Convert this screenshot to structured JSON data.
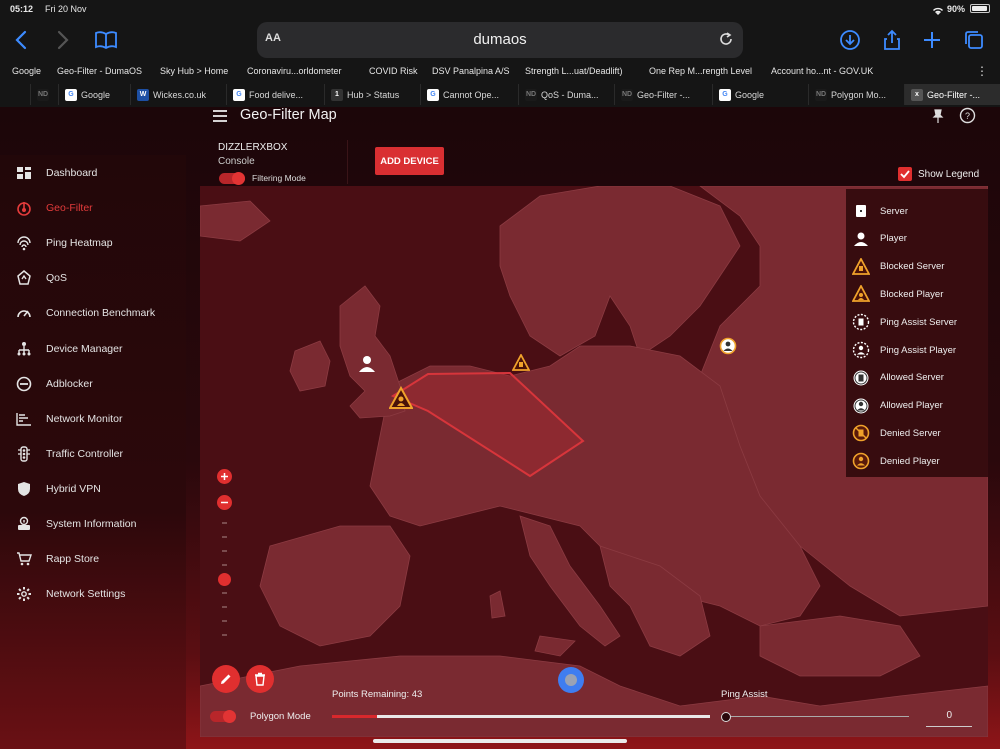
{
  "status_bar": {
    "time": "05:12",
    "date": "Fri 20 Nov",
    "battery": "90%"
  },
  "browser": {
    "text_size_label": "AA",
    "url": "dumaos",
    "bookmarks": [
      "Google",
      "Geo-Filter - DumaOS",
      "Sky Hub > Home",
      "Coronaviru...orldometer",
      "COVID Risk",
      "DSV Panalpina A/S",
      "Strength L...uat/Deadlift)",
      "One Rep M...rength Level",
      "Account ho...nt - GOV.UK"
    ],
    "tabs": [
      {
        "label": "",
        "fav": "ND",
        "favbg": "#1a1a1a",
        "favcolor": "#777"
      },
      {
        "label": "Google",
        "fav": "G",
        "favbg": "#fff",
        "favcolor": "#4285f4"
      },
      {
        "label": "Wickes.co.uk",
        "fav": "W",
        "favbg": "#1d4fa3",
        "favcolor": "#fff"
      },
      {
        "label": "Food delive...",
        "fav": "G",
        "favbg": "#fff",
        "favcolor": "#4285f4"
      },
      {
        "label": "Hub > Status",
        "fav": "1",
        "favbg": "#333",
        "favcolor": "#fff"
      },
      {
        "label": "Cannot Ope...",
        "fav": "G",
        "favbg": "#fff",
        "favcolor": "#4285f4"
      },
      {
        "label": "QoS - Duma...",
        "fav": "ND",
        "favbg": "#1a1a1a",
        "favcolor": "#777"
      },
      {
        "label": "Geo-Filter -...",
        "fav": "ND",
        "favbg": "#1a1a1a",
        "favcolor": "#777"
      },
      {
        "label": "Google",
        "fav": "G",
        "favbg": "#fff",
        "favcolor": "#4285f4"
      },
      {
        "label": "Polygon Mo...",
        "fav": "ND",
        "favbg": "#1a1a1a",
        "favcolor": "#777"
      },
      {
        "label": "Geo-Filter -...",
        "fav": "x",
        "favbg": "#555",
        "favcolor": "#fff",
        "active": true
      }
    ]
  },
  "app": {
    "title": "Geo-Filter Map"
  },
  "sidebar": {
    "items": [
      {
        "label": "Dashboard",
        "icon": "dashboard-icon"
      },
      {
        "label": "Geo-Filter",
        "icon": "geo-filter-icon",
        "active": true
      },
      {
        "label": "Ping Heatmap",
        "icon": "ping-heatmap-icon"
      },
      {
        "label": "QoS",
        "icon": "qos-icon"
      },
      {
        "label": "Connection Benchmark",
        "icon": "speedometer-icon"
      },
      {
        "label": "Device Manager",
        "icon": "device-tree-icon"
      },
      {
        "label": "Adblocker",
        "icon": "block-icon"
      },
      {
        "label": "Network Monitor",
        "icon": "monitor-icon"
      },
      {
        "label": "Traffic Controller",
        "icon": "traffic-light-icon"
      },
      {
        "label": "Hybrid VPN",
        "icon": "shield-icon"
      },
      {
        "label": "System Information",
        "icon": "system-info-icon"
      },
      {
        "label": "Rapp Store",
        "icon": "cart-icon"
      },
      {
        "label": "Network Settings",
        "icon": "gear-icon"
      }
    ]
  },
  "device": {
    "name": "DIZZLERXBOX",
    "type": "Console",
    "filter_label": "Filtering Mode",
    "add_button": "ADD DEVICE"
  },
  "legend": {
    "toggle_label": "Show Legend",
    "items": [
      "Server",
      "Player",
      "Blocked Server",
      "Blocked Player",
      "Ping Assist Server",
      "Ping Assist Player",
      "Allowed Server",
      "Allowed Player",
      "Denied Server",
      "Denied Player"
    ]
  },
  "bottom": {
    "polygon_label": "Polygon Mode",
    "points_remaining": "Points Remaining: 43",
    "points_remaining_fraction": 0.12,
    "ping_assist_label": "Ping Assist",
    "ping_assist_value": "0"
  },
  "colors": {
    "accent": "#e02f2f",
    "warning": "#f0a22b",
    "sidebar_active": "#e33b3b"
  }
}
